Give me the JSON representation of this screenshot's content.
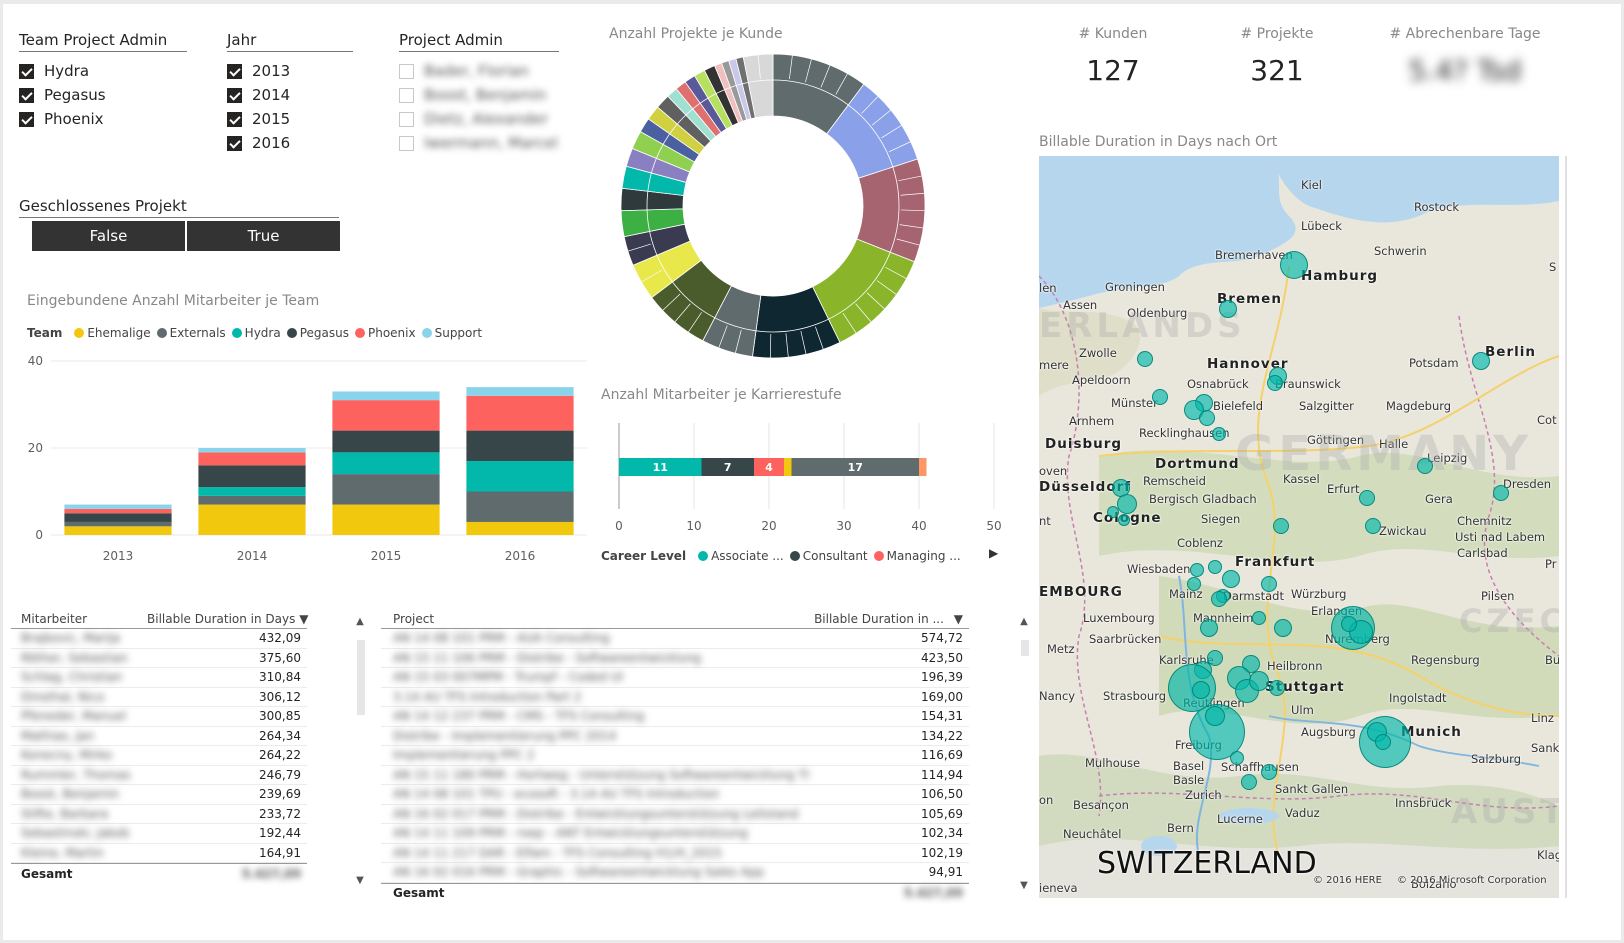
{
  "slicers": {
    "team_admin": {
      "title": "Team Project Admin",
      "items": [
        {
          "label": "Hydra",
          "checked": true
        },
        {
          "label": "Pegasus",
          "checked": true
        },
        {
          "label": "Phoenix",
          "checked": true
        }
      ]
    },
    "jahr": {
      "title": "Jahr",
      "items": [
        {
          "label": "2013",
          "checked": true
        },
        {
          "label": "2014",
          "checked": true
        },
        {
          "label": "2015",
          "checked": true
        },
        {
          "label": "2016",
          "checked": true
        }
      ]
    },
    "project_admin": {
      "title": "Project Admin",
      "items": [
        {
          "label": "Bader, Florian",
          "checked": false
        },
        {
          "label": "Boost, Benjamin",
          "checked": false
        },
        {
          "label": "Dietz, Alexander",
          "checked": false
        },
        {
          "label": "Iwermann, Marcel",
          "checked": false
        }
      ]
    },
    "geschlossen": {
      "title": "Geschlossenes Projekt",
      "false_label": "False",
      "true_label": "True"
    }
  },
  "cards": {
    "kunden": {
      "label": "# Kunden",
      "value": "127"
    },
    "projekte": {
      "label": "# Projekte",
      "value": "321"
    },
    "tage": {
      "label": "# Abrechenbare Tage",
      "value": "5.4? Tsd"
    }
  },
  "titles": {
    "donut": "Anzahl Projekte je Kunde",
    "bar_team": "Eingebundene Anzahl Mitarbeiter je Team",
    "career": "Anzahl Mitarbeiter je Karrierestufe",
    "map": "Billable Duration in Days nach Ort"
  },
  "colors": {
    "Ehemalige": "#F2C80F",
    "Externals": "#5F6B6D",
    "Hydra": "#01B8AA",
    "Pegasus": "#374649",
    "Phoenix": "#FD625E",
    "Support": "#8AD4EB",
    "Managing": "#FE9666"
  },
  "chart_data": [
    {
      "type": "bar",
      "title": "Eingebundene Anzahl Mitarbeiter je Team",
      "legend_title": "Team",
      "categories": [
        "2013",
        "2014",
        "2015",
        "2016"
      ],
      "ylim": [
        0,
        40
      ],
      "yticks": [
        0,
        20,
        40
      ],
      "stacked": true,
      "series": [
        {
          "name": "Ehemalige",
          "values": [
            2,
            7,
            7,
            3
          ]
        },
        {
          "name": "Externals",
          "values": [
            1,
            2,
            7,
            7
          ]
        },
        {
          "name": "Hydra",
          "values": [
            0,
            2,
            5,
            7
          ]
        },
        {
          "name": "Pegasus",
          "values": [
            2,
            5,
            5,
            7
          ]
        },
        {
          "name": "Phoenix",
          "values": [
            1,
            3,
            7,
            8
          ]
        },
        {
          "name": "Support",
          "values": [
            1,
            1,
            2,
            2
          ]
        }
      ]
    },
    {
      "type": "bar",
      "title": "Anzahl Mitarbeiter je Karrierestufe",
      "orientation": "horizontal",
      "stacked": true,
      "xlim": [
        0,
        50
      ],
      "xticks": [
        0,
        10,
        20,
        30,
        40,
        50
      ],
      "legend_title": "Career Level",
      "legend_entries": [
        "Associate ...",
        "Consultant",
        "Managing ..."
      ],
      "segments": [
        {
          "color": "#01B8AA",
          "value": 11,
          "label": "11"
        },
        {
          "color": "#374649",
          "value": 7,
          "label": "7"
        },
        {
          "color": "#FD625E",
          "value": 4,
          "label": "4"
        },
        {
          "color": "#F2C80F",
          "value": 1,
          "label": ""
        },
        {
          "color": "#5F6B6D",
          "value": 17,
          "label": "17"
        },
        {
          "color": "#FE9666",
          "value": 1,
          "label": ""
        }
      ]
    },
    {
      "type": "pie",
      "title": "Anzahl Projekte je Kunde",
      "donut": true,
      "major_slices": [
        {
          "color": "#5F6B6D",
          "value": 26
        },
        {
          "color": "#8AA0E8",
          "value": 25
        },
        {
          "color": "#A66471",
          "value": 28
        },
        {
          "color": "#8AB52A",
          "value": 30
        },
        {
          "color": "#0F2730",
          "value": 24
        },
        {
          "color": "#5F6B6D",
          "value": 14
        },
        {
          "color": "#4A5C2C",
          "value": 18
        },
        {
          "color": "#E8E84A",
          "value": 10
        },
        {
          "color": "#3A3A50",
          "value": 8
        },
        {
          "color": "#3CB043",
          "value": 7
        },
        {
          "color": "#2F3A3C",
          "value": 6
        },
        {
          "color": "#01B8AA",
          "value": 6
        },
        {
          "color": "#8A7FC0",
          "value": 5
        },
        {
          "color": "#90D050",
          "value": 5
        },
        {
          "color": "#4A60A0",
          "value": 4
        },
        {
          "color": "#D0D040",
          "value": 4
        },
        {
          "color": "#606060",
          "value": 4
        },
        {
          "color": "#A0E0D0",
          "value": 3
        },
        {
          "color": "#E07070",
          "value": 3
        },
        {
          "color": "#5A5A9A",
          "value": 3
        },
        {
          "color": "#B8E060",
          "value": 3
        },
        {
          "color": "#333333",
          "value": 3
        },
        {
          "color": "#F0C0C0",
          "value": 2
        },
        {
          "color": "#999999",
          "value": 2
        },
        {
          "color": "#C8C8E8",
          "value": 2
        },
        {
          "color": "#707070",
          "value": 2
        },
        {
          "color": "#D8D8D8",
          "value": 8
        }
      ]
    }
  ],
  "table_employees": {
    "headers": [
      "Mitarbeiter",
      "Billable Duration in Days"
    ],
    "rows": [
      [
        "Brajkovic, Marija",
        "432,09"
      ],
      [
        "Röther, Sebastian",
        "375,60"
      ],
      [
        "Schlag, Christian",
        "310,84"
      ],
      [
        "Dinsthal, Nico",
        "306,12"
      ],
      [
        "Pfeneder, Manuel",
        "300,85"
      ],
      [
        "Mathias, Jan",
        "264,34"
      ],
      [
        "Konecny, Mirko",
        "264,22"
      ],
      [
        "Rummler, Thomas",
        "246,79"
      ],
      [
        "Boost, Benjamin",
        "239,69"
      ],
      [
        "Stifte, Barbara",
        "233,72"
      ],
      [
        "Sebastinski, Jakob",
        "192,44"
      ],
      [
        "Kleine, Martin",
        "164,91"
      ]
    ],
    "total_label": "Gesamt",
    "total_value": "5.427,09"
  },
  "table_projects": {
    "headers": [
      "Project",
      "Billable Duration in ..."
    ],
    "rows": [
      [
        "AN 14 08 101 PRM - AUA Consulting",
        "574,72"
      ],
      [
        "AN 15 11 106 PRM - Distribe - Softwareentwicklung",
        "423,50"
      ],
      [
        "AN 15 03 007MPM - Trumpf - Coded UI",
        "196,39"
      ],
      [
        "3.14 AU TFS Introduction Part 2",
        "169,00"
      ],
      [
        "AN 14 12 237 PRM - CMS - TFS Consulting",
        "154,31"
      ],
      [
        "Distribe - Implementierung PPC 2014",
        "134,22"
      ],
      [
        "Implementierung PPC 2",
        "116,69"
      ],
      [
        "AN 15 11 180 PRM - Hortweg - Unterstützung Softwareentwicklung TI",
        "114,94"
      ],
      [
        "AN 14 08 101 TPU - ecosoft - 3.14 AU TFS Introduction",
        "106,50"
      ],
      [
        "AN 16 02 017 PRM - Distribe - Entwicklungsunterstützung Leitstand",
        "105,69"
      ],
      [
        "AN 14 11 109 PRM - roep - ANT Entwicklungsunterstützung",
        "102,34"
      ],
      [
        "AN 14 11 217 DAR - Elfam - TFS Consulting H1/H_2015",
        "102,19"
      ],
      [
        "AN 16 02 016 PRM - Graphic - Softwareentwicklung Sales App",
        "94,91"
      ]
    ],
    "total_label": "Gesamt",
    "total_value": "5.427,09"
  },
  "map": {
    "labels": {
      "kiel": "Kiel",
      "rostock": "Rostock",
      "lubeck": "Lübeck",
      "bremerhaven": "Bremerhaven",
      "hamburg": "Hamburg",
      "schwerin": "Schwerin",
      "groningen": "Groningen",
      "assen": "Assen",
      "bremen": "Bremen",
      "oldenburg": "Oldenburg",
      "zwolle": "Zwolle",
      "hannover": "Hannover",
      "potsdam": "Potsdam",
      "berlin": "Berlin",
      "apeldoorn": "Apeldoorn",
      "osnabruck": "Osnabrück",
      "braunschweig": "Braunswick",
      "munster": "Münster",
      "bielefeld": "Bielefeld",
      "salzgitter": "Salzgitter",
      "magdeburg": "Magdeburg",
      "arnhem": "Arnhem",
      "recklinghausen": "Recklinghausen",
      "gottingen": "Göttingen",
      "halle": "Halle",
      "duisburg": "Duisburg",
      "dortmund": "Dortmund",
      "leipzig": "Leipzig",
      "remscheid": "Remscheid",
      "kassel": "Kassel",
      "dusseldorf": "Düsseldorf",
      "erfurt": "Erfurt",
      "dresden": "Dresden",
      "bergisch": "Bergisch Gladbach",
      "gera": "Gera",
      "cologne": "Cologne",
      "siegen": "Siegen",
      "chemnitz": "Chemnitz",
      "zwickau": "Zwickau",
      "usti": "Usti nad Labem",
      "carlsbad": "Carlsbad",
      "koblenz": "Coblenz",
      "frankfurt": "Frankfurt",
      "wiesbaden": "Wiesbaden",
      "mainz": "Mainz",
      "darmstadt": "Darmstadt",
      "wurzburg": "Würzburg",
      "luxembourg_country": "EMBOURG",
      "luxembourg": "Luxembourg",
      "erlangen": "Erlangen",
      "pilsen": "Pilsen",
      "saarbrucken": "Saarbrücken",
      "mannheim": "Mannheim",
      "nuremberg": "Nuremberg",
      "metz": "Metz",
      "karlsruhe": "Karlsruhe",
      "heilbronn": "Heilbronn",
      "regensburg": "Regensburg",
      "nancy": "Nancy",
      "strasbourg": "Strasbourg",
      "stuttgart": "Stuttgart",
      "ingolstadt": "Ingolstadt",
      "reutlingen": "Reutlingen",
      "ulm": "Ulm",
      "augsburg": "Augsburg",
      "munich": "Munich",
      "linz": "Linz",
      "freiburg": "Freiburg",
      "mulhouse": "Mulhouse",
      "basel": "Basel",
      "basle": "Basle",
      "schaffhausen": "Schaffhausen",
      "salzburg": "Salzburg",
      "zurich": "Zurich",
      "sanktgallen": "Sankt Gallen",
      "besancon": "Besançon",
      "innsbruck": "Innsbruck",
      "vaduz": "Vaduz",
      "neuchatel": "Neuchâtel",
      "bern": "Bern",
      "lucerne": "Lucerne",
      "switzerland": "SWITZERLAND",
      "germany": "GERMANY",
      "czech": "CZEC",
      "austria": "AUST",
      "nederland": "ERLANDS",
      "geneva": "ieneva",
      "bolzano": "Bolzano",
      "len": "len",
      "mere": "mere",
      "oven": "oven",
      "nt": "nt",
      "on": "on",
      "cot": "Cot",
      "s": "S",
      "pr": "Pr",
      "bu": "Bu",
      "sank": "Sank",
      "klag": "Klag"
    },
    "copyright_here": "© 2016 HERE",
    "copyright_ms": "© 2016 Microsoft Corporation"
  }
}
